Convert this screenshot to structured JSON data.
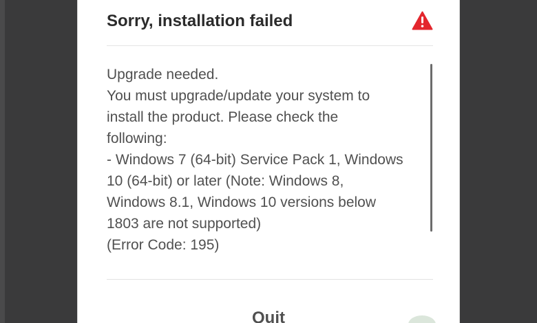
{
  "dialog": {
    "title": "Sorry, installation failed",
    "warning_icon": "warning-triangle-icon",
    "message_lines": [
      "Upgrade needed.",
      "You must upgrade/update your system to",
      "install the product. Please check the",
      "following:",
      "- Windows 7 (64-bit) Service Pack 1, Windows",
      "10 (64-bit) or later (Note: Windows 8,",
      "Windows 8.1, Windows 10 versions below",
      "1803 are not supported)",
      "(Error Code: 195)"
    ],
    "quit_label": "Quit"
  },
  "colors": {
    "background": "#3a3a3b",
    "dialog": "#ffffff",
    "title": "#2b2b2b",
    "message": "#505050",
    "warning": "#e3262d"
  }
}
